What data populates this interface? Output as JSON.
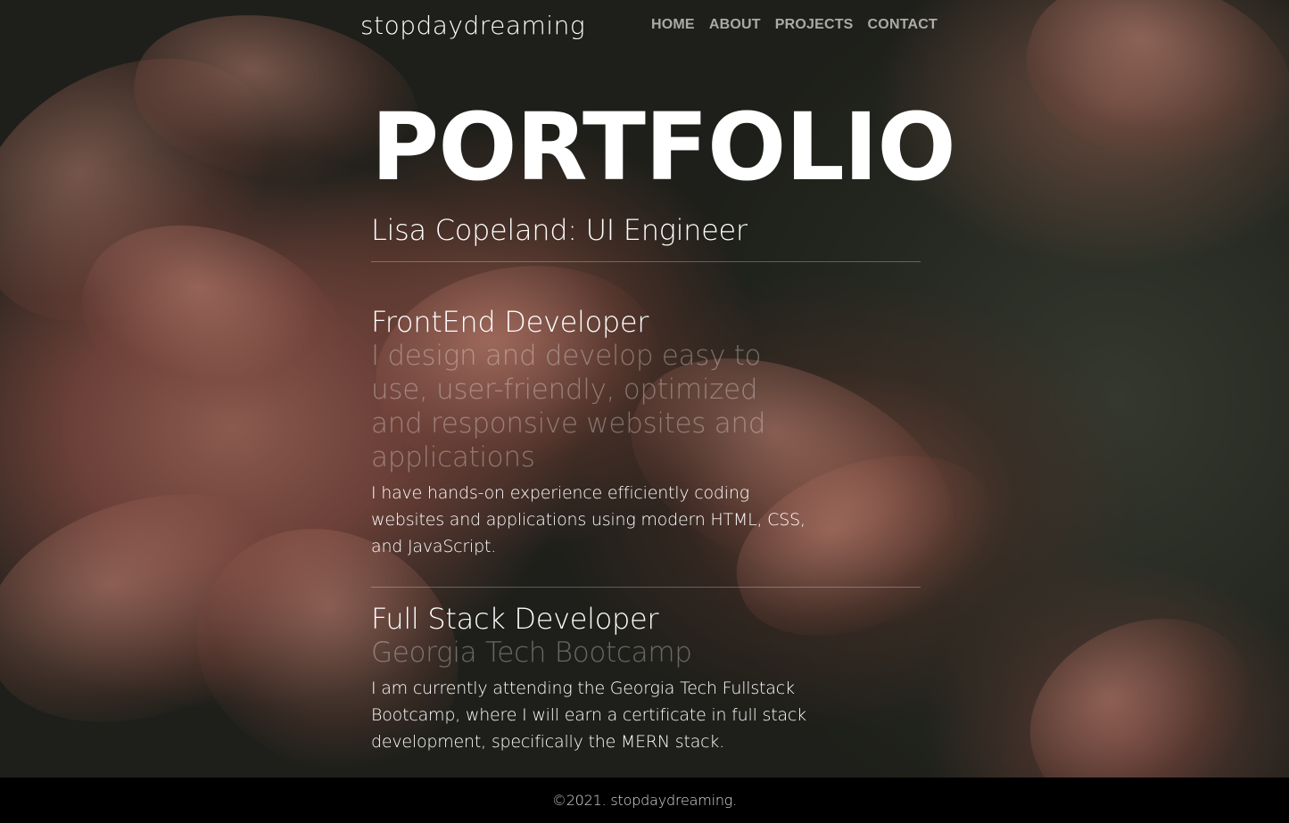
{
  "site": {
    "logo": "stopdaydreaming"
  },
  "nav": {
    "items": [
      {
        "label": "HOME"
      },
      {
        "label": "ABOUT"
      },
      {
        "label": "PROJECTS"
      },
      {
        "label": "CONTACT"
      }
    ]
  },
  "hero": {
    "title": "PORTFOLIO",
    "subtitle": "Lisa Copeland: UI Engineer"
  },
  "sections": [
    {
      "title": "FrontEnd Developer",
      "tagline": "I design and develop easy to use, user-friendly, optimized and responsive websites and applications",
      "body": "I have hands-on experience efficiently coding websites and applications using modern HTML, CSS, and JavaScript."
    },
    {
      "title": "Full Stack Developer",
      "tagline": "Georgia Tech Bootcamp",
      "body": "I am currently attending the Georgia Tech Fullstack Bootcamp, where I will earn a certificate in full stack development, specifically the MERN stack."
    }
  ],
  "footer": {
    "text": "©2021. stopdaydreaming."
  },
  "colors": {
    "footer_bg": "#000000",
    "tagline": "rgba(255,255,255,0.32)"
  }
}
